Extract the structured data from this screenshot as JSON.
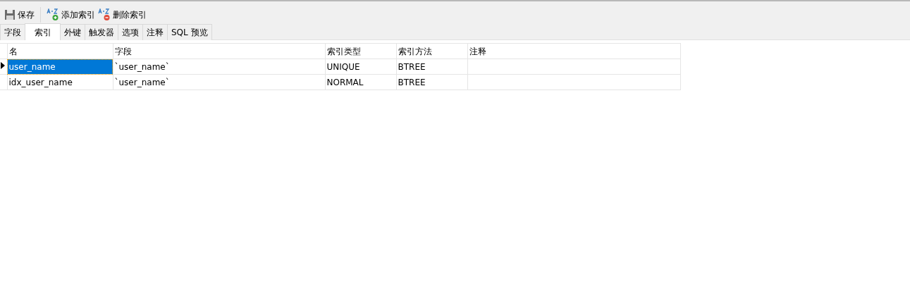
{
  "toolbar": [
    {
      "label": "保存",
      "kind": "save"
    },
    {
      "label": "添加索引",
      "kind": "add"
    },
    {
      "label": "删除索引",
      "kind": "delete"
    }
  ],
  "tabs": [
    {
      "label": "字段",
      "selected": false
    },
    {
      "label": "索引",
      "selected": true
    },
    {
      "label": "外键",
      "selected": false
    },
    {
      "label": "触发器",
      "selected": false
    },
    {
      "label": "选项",
      "selected": false
    },
    {
      "label": "注释",
      "selected": false
    },
    {
      "label": "SQL 预览",
      "selected": false
    }
  ],
  "table": {
    "columns": [
      "名",
      "字段",
      "索引类型",
      "索引方法",
      "注释"
    ],
    "rows": [
      {
        "selected": true,
        "cells": [
          "user_name",
          "`user_name`",
          "UNIQUE",
          "BTREE",
          ""
        ]
      },
      {
        "selected": false,
        "cells": [
          "idx_user_name",
          "`user_name`",
          "NORMAL",
          "BTREE",
          ""
        ]
      }
    ]
  }
}
